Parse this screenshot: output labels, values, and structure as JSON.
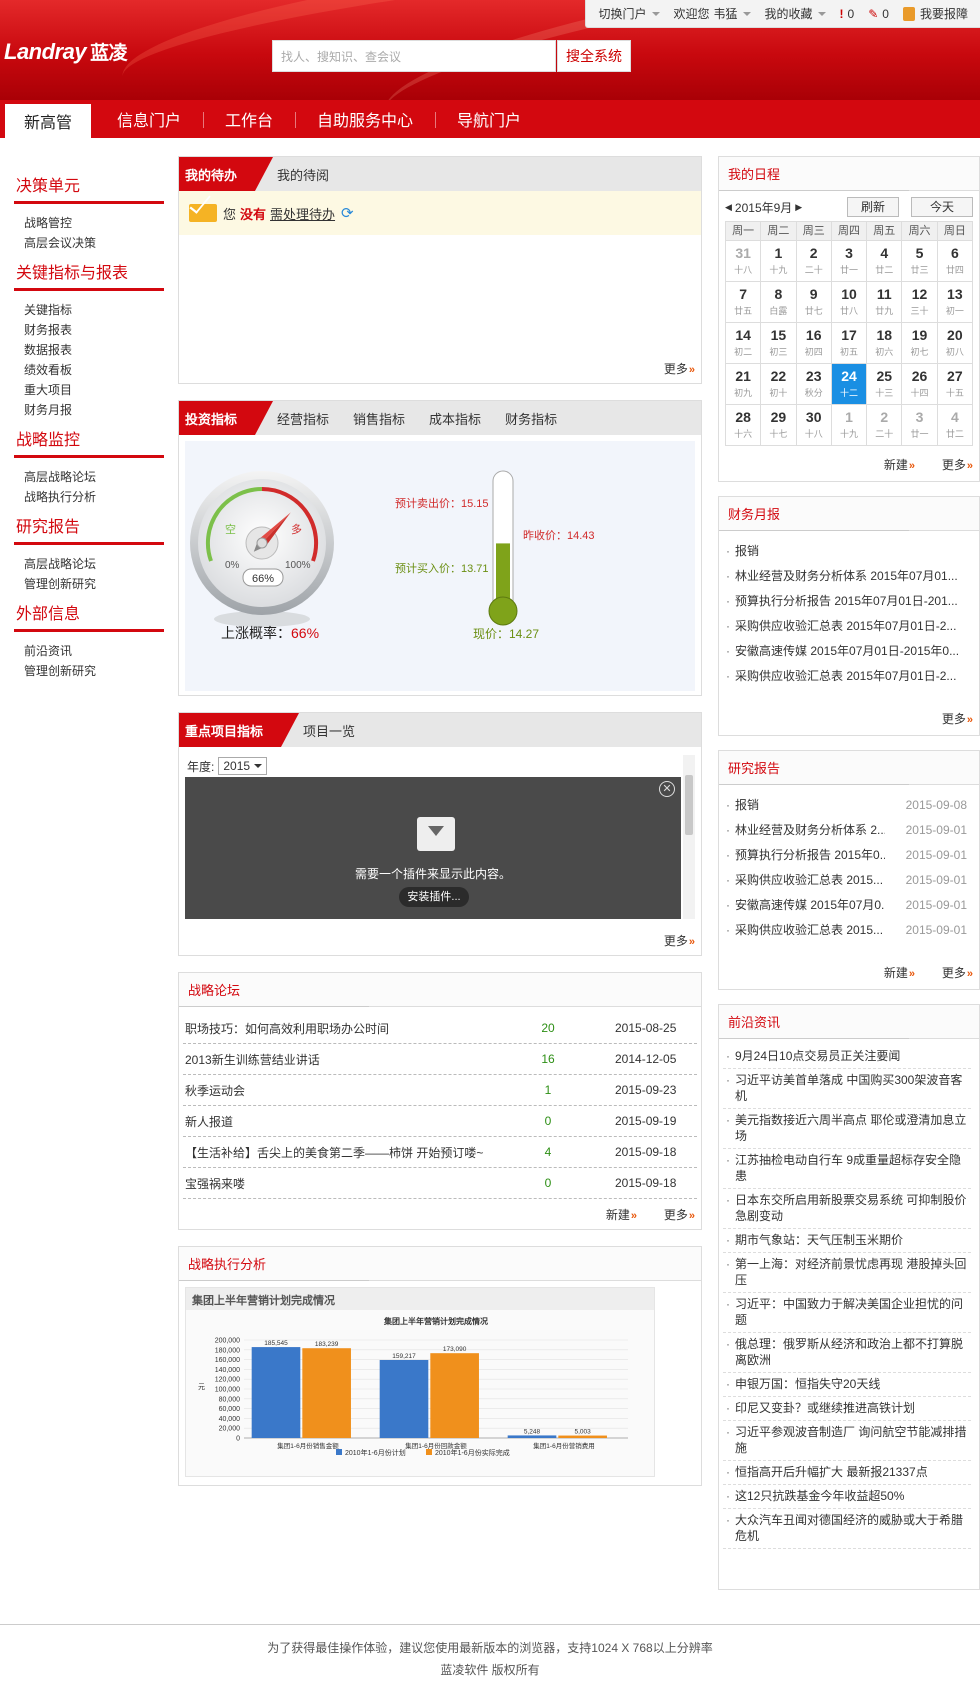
{
  "topbar": {
    "switch_portal": "切换门户",
    "welcome": "欢迎您",
    "username": "韦猛",
    "favorites": "我的收藏",
    "count_a": "0",
    "count_b": "0",
    "report_label": "我要报障"
  },
  "brand": {
    "logo_en": "Landray",
    "logo_cn": "蓝凌"
  },
  "search": {
    "placeholder": "找人、搜知识、查会议",
    "button": "搜全系统"
  },
  "nav": {
    "tabs": [
      "新高管",
      "信息门户",
      "工作台",
      "自助服务中心",
      "导航门户"
    ]
  },
  "sidebar": {
    "groups": [
      {
        "title": "决策单元",
        "items": [
          "战略管控",
          "高层会议决策"
        ]
      },
      {
        "title": "关键指标与报表",
        "items": [
          "关键指标",
          "财务报表",
          "数据报表",
          "绩效看板",
          "重大项目",
          "财务月报"
        ]
      },
      {
        "title": "战略监控",
        "items": [
          "高层战略论坛",
          "战略执行分析"
        ]
      },
      {
        "title": "研究报告",
        "items": [
          "高层战略论坛",
          "管理创新研究"
        ]
      },
      {
        "title": "外部信息",
        "items": [
          "前沿资讯",
          "管理创新研究"
        ]
      }
    ]
  },
  "todo": {
    "tab_active": "我的待办",
    "tab_other": "我的待阅",
    "msg_prefix": "您",
    "msg_none": "没有",
    "msg_link": "需处理待办",
    "more": "更多"
  },
  "invest": {
    "tabs": [
      "投资指标",
      "经营指标",
      "销售指标",
      "成本指标",
      "财务指标"
    ],
    "gauge": {
      "empty": "空",
      "full": "多",
      "min": "0%",
      "max": "100%",
      "value_pct": 66,
      "value_text": "66%"
    },
    "rise_label": "上涨概率：",
    "rise_value": "66%",
    "expected_sell": "预计卖出价：15.15",
    "yesterday": "昨收价：14.43",
    "expected_buy": "预计买入价：13.71",
    "current": "现价：14.27",
    "thermo_fill_fraction": 0.52
  },
  "projects": {
    "tab_active": "重点项目指标",
    "tab_other": "项目一览",
    "year_label": "年度:",
    "year_value": "2015",
    "plugin_msg": "需要一个插件来显示此内容。",
    "plugin_btn": "安装插件...",
    "more": "更多"
  },
  "forum": {
    "title": "战略论坛",
    "rows": [
      {
        "t": "职场技巧：如何高效利用职场办公时间",
        "n": "20",
        "d": "2015-08-25"
      },
      {
        "t": "2013新生训练营结业讲话",
        "n": "16",
        "d": "2014-12-05"
      },
      {
        "t": "秋季运动会",
        "n": "1",
        "d": "2015-09-23"
      },
      {
        "t": "新人报道",
        "n": "0",
        "d": "2015-09-19"
      },
      {
        "t": "【生活补给】舌尖上的美食第二季——柿饼 开始预订喽~",
        "n": "4",
        "d": "2015-09-18"
      },
      {
        "t": "宝强祸来喽",
        "n": "0",
        "d": "2015-09-18"
      }
    ],
    "new": "新建",
    "more": "更多"
  },
  "exec": {
    "title": "战略执行分析",
    "subtitle": "集团上半年营销计划完成情况"
  },
  "chart_data": {
    "type": "bar",
    "title": "集团上半年营销计划完成情况",
    "categories": [
      "集团1-6月份销售金额",
      "集团1-6月份回款金额",
      "集团1-6月份营销费用"
    ],
    "series": [
      {
        "name": "2010年1-6月份计划",
        "values": [
          185545,
          159217,
          5248
        ],
        "color": "#3a78c9"
      },
      {
        "name": "2010年1-6月份实际完成",
        "values": [
          183239,
          173090,
          5003
        ],
        "color": "#f0901c"
      }
    ],
    "ylabel": "元",
    "ylim": [
      0,
      200000
    ],
    "yticks": [
      "200,000",
      "180,000",
      "160,000",
      "140,000",
      "120,000",
      "100,000",
      "80,000",
      "60,000",
      "40,000",
      "20,000",
      "0"
    ],
    "labels": [
      [
        "185,545",
        "159,217",
        "5,248"
      ],
      [
        "183,239",
        "173,090",
        "5,003"
      ]
    ]
  },
  "schedule": {
    "title": "我的日程",
    "month": "2015年9月",
    "refresh": "刷新",
    "today": "今天",
    "weekdays": [
      "周一",
      "周二",
      "周三",
      "周四",
      "周五",
      "周六",
      "周日"
    ],
    "days": [
      {
        "n": "31",
        "l": "十八",
        "dim": true
      },
      {
        "n": "1",
        "l": "十九"
      },
      {
        "n": "2",
        "l": "二十"
      },
      {
        "n": "3",
        "l": "廿一"
      },
      {
        "n": "4",
        "l": "廿二"
      },
      {
        "n": "5",
        "l": "廿三"
      },
      {
        "n": "6",
        "l": "廿四"
      },
      {
        "n": "7",
        "l": "廿五"
      },
      {
        "n": "8",
        "l": "白露"
      },
      {
        "n": "9",
        "l": "廿七"
      },
      {
        "n": "10",
        "l": "廿八"
      },
      {
        "n": "11",
        "l": "廿九"
      },
      {
        "n": "12",
        "l": "三十"
      },
      {
        "n": "13",
        "l": "初一"
      },
      {
        "n": "14",
        "l": "初二"
      },
      {
        "n": "15",
        "l": "初三"
      },
      {
        "n": "16",
        "l": "初四"
      },
      {
        "n": "17",
        "l": "初五"
      },
      {
        "n": "18",
        "l": "初六"
      },
      {
        "n": "19",
        "l": "初七"
      },
      {
        "n": "20",
        "l": "初八"
      },
      {
        "n": "21",
        "l": "初九"
      },
      {
        "n": "22",
        "l": "初十"
      },
      {
        "n": "23",
        "l": "秋分"
      },
      {
        "n": "24",
        "l": "十二",
        "today": true
      },
      {
        "n": "25",
        "l": "十三"
      },
      {
        "n": "26",
        "l": "十四"
      },
      {
        "n": "27",
        "l": "十五"
      },
      {
        "n": "28",
        "l": "十六"
      },
      {
        "n": "29",
        "l": "十七"
      },
      {
        "n": "30",
        "l": "十八"
      },
      {
        "n": "1",
        "l": "十九",
        "dim": true
      },
      {
        "n": "2",
        "l": "二十",
        "dim": true
      },
      {
        "n": "3",
        "l": "廿一",
        "dim": true
      },
      {
        "n": "4",
        "l": "廿二",
        "dim": true
      }
    ],
    "new": "新建",
    "more": "更多"
  },
  "finance": {
    "title": "财务月报",
    "items": [
      "报销",
      "林业经营及财务分析体系 2015年07月01...",
      "预算执行分析报告 2015年07月01日-201...",
      "采购供应收验汇总表 2015年07月01日-2...",
      "安徽高速传媒 2015年07月01日-2015年0...",
      "采购供应收验汇总表 2015年07月01日-2..."
    ],
    "more": "更多"
  },
  "research": {
    "title": "研究报告",
    "items": [
      {
        "t": "报销",
        "d": "2015-09-08"
      },
      {
        "t": "林业经营及财务分析体系 2...",
        "d": "2015-09-01"
      },
      {
        "t": "预算执行分析报告 2015年0...",
        "d": "2015-09-01"
      },
      {
        "t": "采购供应收验汇总表 2015...",
        "d": "2015-09-01"
      },
      {
        "t": "安徽高速传媒 2015年07月0...",
        "d": "2015-09-01"
      },
      {
        "t": "采购供应收验汇总表 2015...",
        "d": "2015-09-01"
      }
    ],
    "new": "新建",
    "more": "更多"
  },
  "frontier": {
    "title": "前沿资讯",
    "items": [
      "9月24日10点交易员正关注要闻",
      "习近平访美首单落成 中国购买300架波音客机",
      "美元指数接近六周半高点 耶伦或澄清加息立场",
      "江苏抽检电动自行车 9成重量超标存安全隐患",
      "日本东交所启用新股票交易系统 可抑制股价急剧变动",
      "期市气象站：天气压制玉米期价",
      "第一上海：对经济前景忧虑再现 港股掉头回压",
      "习近平：中国致力于解决美国企业担忧的问题",
      "俄总理：俄罗斯从经济和政治上都不打算脱离欧洲",
      "申银万国：恒指失守20天线",
      "印尼又变卦？或继续推进高铁计划",
      "习近平参观波音制造厂 询问航空节能减排措施",
      "恒指高开后升幅扩大 最新报21337点",
      "这12只抗跌基金今年收益超50%",
      "大众汽车丑闻对德国经济的威胁或大于希腊危机"
    ]
  },
  "footer": {
    "line1": "为了获得最佳操作体验，建议您使用最新版本的浏览器，支持1024 X 768以上分辨率",
    "line2": "蓝凌软件 版权所有"
  },
  "colors": {
    "brand_red": "#d3080f",
    "today_blue": "#1a8fe3",
    "link_orange": "#e8570b"
  }
}
